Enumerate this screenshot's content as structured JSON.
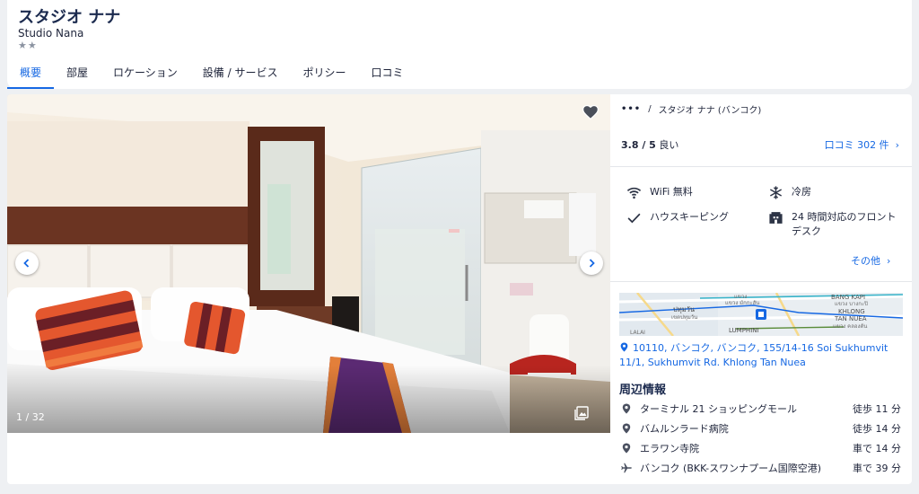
{
  "hotel": {
    "name": "スタジオ ナナ",
    "name_en": "Studio Nana",
    "stars": "★★"
  },
  "tabs": [
    {
      "label": "概要",
      "active": true
    },
    {
      "label": "部屋"
    },
    {
      "label": "ロケーション"
    },
    {
      "label": "設備 / サービス"
    },
    {
      "label": "ポリシー"
    },
    {
      "label": "口コミ"
    }
  ],
  "gallery": {
    "counter": "1 / 32"
  },
  "breadcrumb": {
    "dots": "•••",
    "sep": "/",
    "current": "スタジオ ナナ (バンコク)"
  },
  "rating": {
    "score": "3.8 / 5",
    "label": "良い",
    "reviews_link": "口コミ 302 件"
  },
  "amenities": [
    {
      "label": "WiFi 無料",
      "icon": "wifi-icon"
    },
    {
      "label": "冷房",
      "icon": "snowflake-icon"
    },
    {
      "label": "ハウスキーピング",
      "icon": "check-icon"
    },
    {
      "label": "24 時間対応のフロントデスク",
      "icon": "front-desk-icon"
    }
  ],
  "more_link": "その他",
  "map": {
    "labels": {
      "bang_kapi": "BANG KAPI",
      "bang_kapi_th": "แขวง บางกะปิ",
      "khlong": "KHLONG",
      "tan_nuea": "TAN NUEA",
      "khlong_th": "แขวง คลองตัน",
      "pathum": "ปทุมวัน",
      "pathum_en": "เขตปทุมวัน",
      "makkasan": "แขวง มักกะสัน",
      "lumphini": "LUMPHINI",
      "phaya": "แขวง",
      "lalai": "LALAI"
    }
  },
  "address": "10110, バンコク, バンコク, 155/14-16 Soi Sukhumvit 11/1, Sukhumvit Rd. Khlong Tan Nuea",
  "nearby": {
    "title": "周辺情報",
    "items": [
      {
        "name": "ターミナル 21 ショッピングモール",
        "dist": "徒歩 11 分",
        "icon": "pin-icon"
      },
      {
        "name": "バムルンラード病院",
        "dist": "徒歩 14 分",
        "icon": "pin-icon"
      },
      {
        "name": "エラワン寺院",
        "dist": "車で 14 分",
        "icon": "pin-icon"
      },
      {
        "name": "バンコク (BKK-スワンナプーム国際空港)",
        "dist": "車で 39 分",
        "icon": "plane-icon"
      }
    ]
  },
  "colors": {
    "accent": "#1668e3",
    "title": "#1b2a4e",
    "text": "#1e243a"
  }
}
